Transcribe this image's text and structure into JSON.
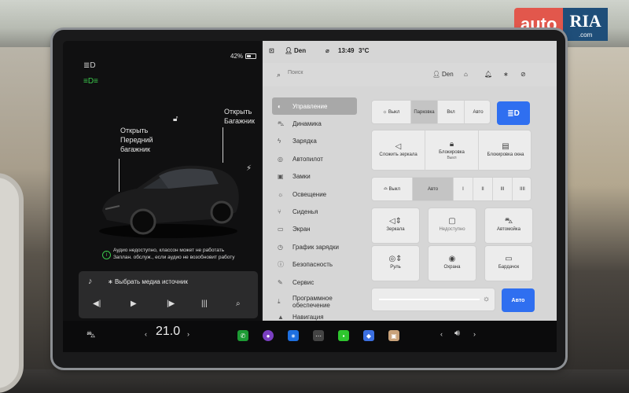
{
  "watermark": {
    "left": "auto",
    "right": "RIA",
    "sub": ".com"
  },
  "status": {
    "battery": "42%",
    "user": "Den",
    "time": "13:49",
    "temp": "3°C"
  },
  "left_panel": {
    "front_trunk": [
      "Открыть",
      "Передний",
      "багажник"
    ],
    "rear_trunk": [
      "Открыть",
      "Багажник"
    ],
    "notice": [
      "Аудио недоступно, классон может не работать",
      "Заплан. обслуж., если аудио не возобновит работу"
    ],
    "media_source": "Выбрать медиа источник"
  },
  "search": {
    "placeholder": "Поиск",
    "user": "Den"
  },
  "sidebar": {
    "items": [
      {
        "label": "Управление",
        "icon": "toggle-icon"
      },
      {
        "label": "Динамика",
        "icon": "car-icon"
      },
      {
        "label": "Зарядка",
        "icon": "bolt-icon"
      },
      {
        "label": "Автопилот",
        "icon": "steering-icon"
      },
      {
        "label": "Замки",
        "icon": "lock-icon"
      },
      {
        "label": "Освещение",
        "icon": "light-icon"
      },
      {
        "label": "Сиденья",
        "icon": "seat-icon"
      },
      {
        "label": "Экран",
        "icon": "screen-icon"
      },
      {
        "label": "График зарядки",
        "icon": "clock-icon"
      },
      {
        "label": "Безопасность",
        "icon": "shield-icon"
      },
      {
        "label": "Сервис",
        "icon": "wrench-icon"
      },
      {
        "label": "Программное обеспечение",
        "icon": "download-icon"
      },
      {
        "label": "Навигация",
        "icon": "nav-icon"
      }
    ]
  },
  "controls": {
    "lights": [
      "Выкл",
      "Парковка",
      "Вкл",
      "Авто"
    ],
    "row2": [
      {
        "label": "Сложить зеркала",
        "sub": ""
      },
      {
        "label": "Блокировка",
        "sub": "Выкл"
      },
      {
        "label": "Блокировка окна",
        "sub": ""
      }
    ],
    "wipers": [
      "Выкл",
      "Авто",
      "I",
      "II",
      "III",
      "IIII"
    ],
    "tiles": [
      "Зеркала",
      "Недоступно",
      "Автомойка",
      "Руль",
      "Охрана",
      "Бардачок"
    ],
    "brightness_auto": "Авто"
  },
  "dock": {
    "temperature": "21.0"
  }
}
